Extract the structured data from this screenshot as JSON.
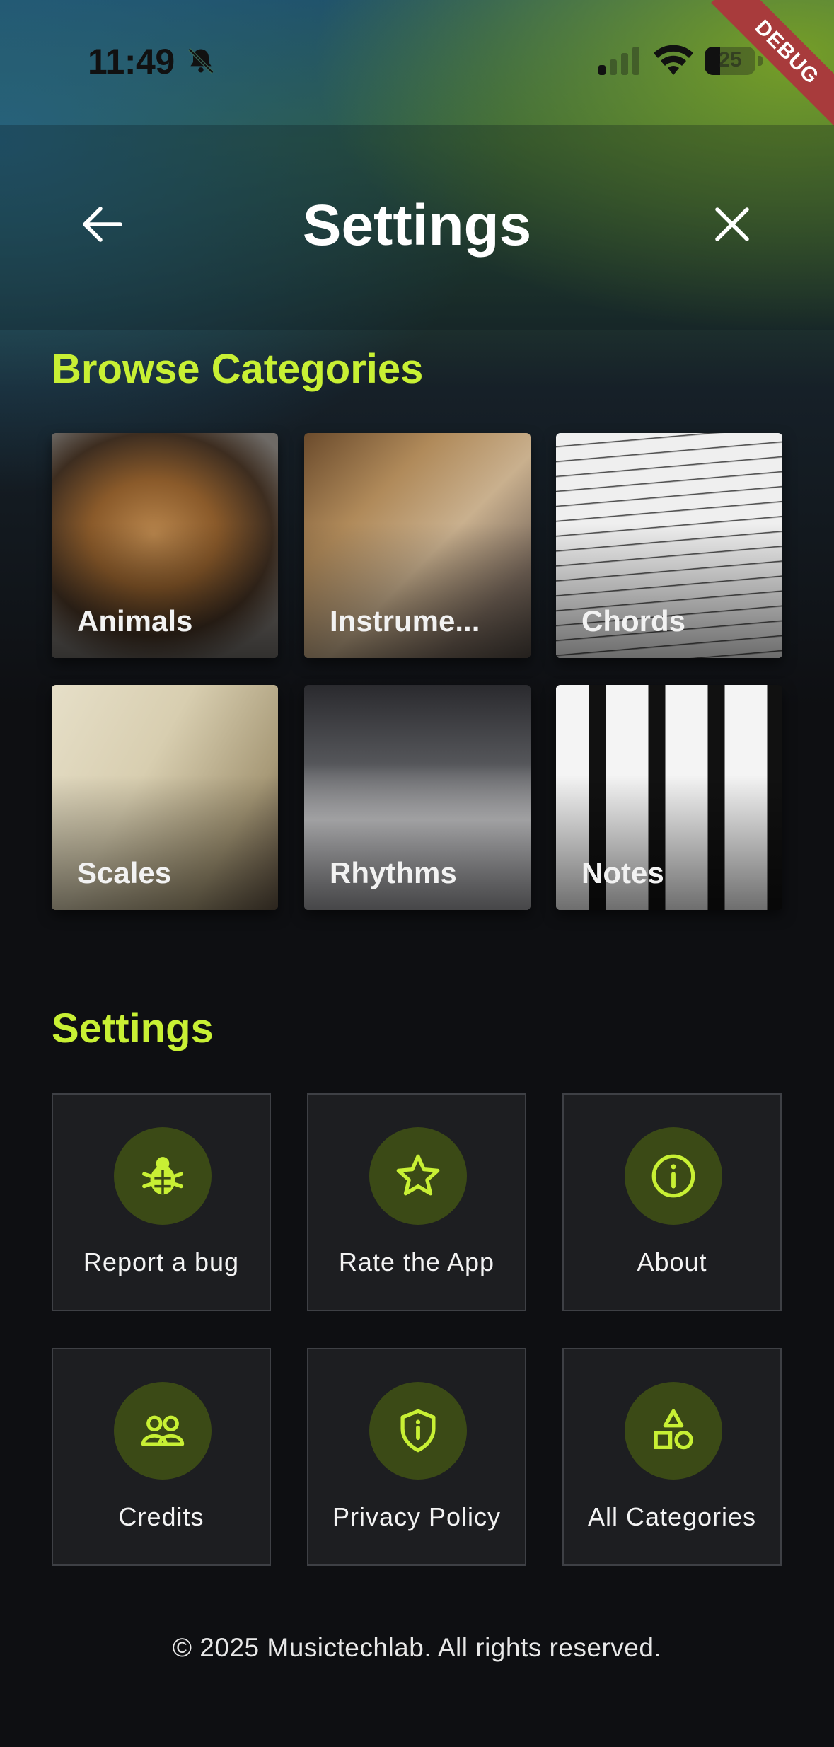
{
  "status_bar": {
    "time": "11:49",
    "battery": "25",
    "debug_label": "DEBUG"
  },
  "header": {
    "title": "Settings"
  },
  "browse": {
    "title": "Browse Categories",
    "items": [
      {
        "label": "Animals"
      },
      {
        "label": "Instrume..."
      },
      {
        "label": "Chords"
      },
      {
        "label": "Scales"
      },
      {
        "label": "Rhythms"
      },
      {
        "label": "Notes"
      }
    ]
  },
  "settings": {
    "title": "Settings",
    "items": [
      {
        "label": "Report a bug",
        "icon": "bug-icon"
      },
      {
        "label": "Rate the App",
        "icon": "star-icon"
      },
      {
        "label": "About",
        "icon": "info-icon"
      },
      {
        "label": "Credits",
        "icon": "people-icon"
      },
      {
        "label": "Privacy Policy",
        "icon": "shield-icon"
      },
      {
        "label": "All Categories",
        "icon": "shapes-icon"
      }
    ]
  },
  "footer": {
    "text": "© 2025 Musictechlab. All rights reserved."
  },
  "colors": {
    "accent": "#c8f034",
    "background": "#0e0f12",
    "tile": "#1d1e21",
    "icon_circle": "#3b4a16"
  }
}
